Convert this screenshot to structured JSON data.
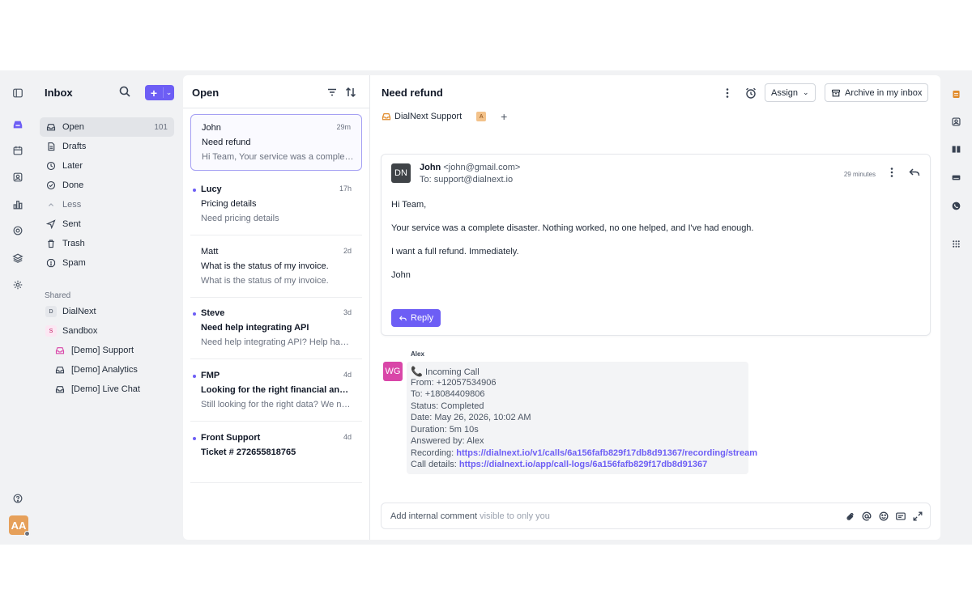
{
  "sidebar": {
    "title": "Inbox",
    "new_button": "+",
    "items": [
      {
        "label": "Open",
        "count": "101"
      },
      {
        "label": "Drafts"
      },
      {
        "label": "Later"
      },
      {
        "label": "Done"
      },
      {
        "label": "Less"
      },
      {
        "label": "Sent"
      },
      {
        "label": "Trash"
      },
      {
        "label": "Spam"
      }
    ],
    "shared_label": "Shared",
    "shared": [
      {
        "badge": "D",
        "label": "DialNext"
      },
      {
        "badge": "S",
        "label": "Sandbox"
      }
    ],
    "sub_inboxes": [
      "[Demo] Support",
      "[Demo] Analytics",
      "[Demo] Live Chat"
    ]
  },
  "user_avatar": "AA",
  "list": {
    "title": "Open",
    "cards": [
      {
        "from": "John",
        "time": "29m",
        "subject": "Need refund",
        "preview": "Hi Team, Your service was a complete disaster. Nothing worked",
        "unread": false
      },
      {
        "from": "Lucy",
        "time": "17h",
        "subject": "Pricing details",
        "preview": "Need pricing details",
        "unread": true
      },
      {
        "from": "Matt",
        "time": "2d",
        "subject": "What is the status of my invoice.",
        "preview": "What is the status of my invoice.",
        "unread": false
      },
      {
        "from": "Steve",
        "time": "3d",
        "subject": "Need help integrating API",
        "preview": "Need help integrating API? Help has arrived",
        "unread": true
      },
      {
        "from": "FMP",
        "time": "4d",
        "subject": "Looking for the right financial and stock data",
        "preview": "Still looking for the right data? We now offer",
        "unread": true
      },
      {
        "from": "Front Support",
        "time": "4d",
        "subject": "Ticket # 272655818765",
        "preview": "",
        "unread": true
      }
    ]
  },
  "conversation": {
    "title": "Need refund",
    "assign_label": "Assign",
    "archive_label": "Archive in my inbox",
    "inbox_tag": "DialNext Support",
    "tag_badge": "A",
    "message": {
      "avatar": "DN",
      "sender_name": "John",
      "sender_email": "<john@gmail.com>",
      "to": "To: support@dialnext.io",
      "time": "29 minutes",
      "body": [
        "Hi Team,",
        "Your service was a complete disaster. Nothing worked, no one helped, and I've had enough.",
        "I want a full refund. Immediately.",
        "John"
      ],
      "reply_label": "Reply"
    },
    "note": {
      "author": "Alex",
      "avatar": "WG",
      "title": "Incoming Call",
      "lines": [
        "From: +12057534906",
        "To: +18084409806",
        "Status: Completed",
        "Date: May 26, 2026, 10:02 AM",
        "Duration: 5m 10s",
        "Answered by: Alex"
      ],
      "recording_label": "Recording:",
      "recording_url": "https://dialnext.io/v1/calls/6a156fafb829f17db8d91367/recording/stream",
      "details_label": "Call details:",
      "details_url": "https://dialnext.io/app/call-logs/6a156fafb829f17db8d91367"
    },
    "composer": {
      "placeholder_main": "Add internal comment",
      "placeholder_hint": "visible to only you"
    }
  },
  "colors": {
    "accent": "#6d5ef5",
    "avatar_user": "#e6a05a",
    "avatar_note": "#d946a8"
  }
}
